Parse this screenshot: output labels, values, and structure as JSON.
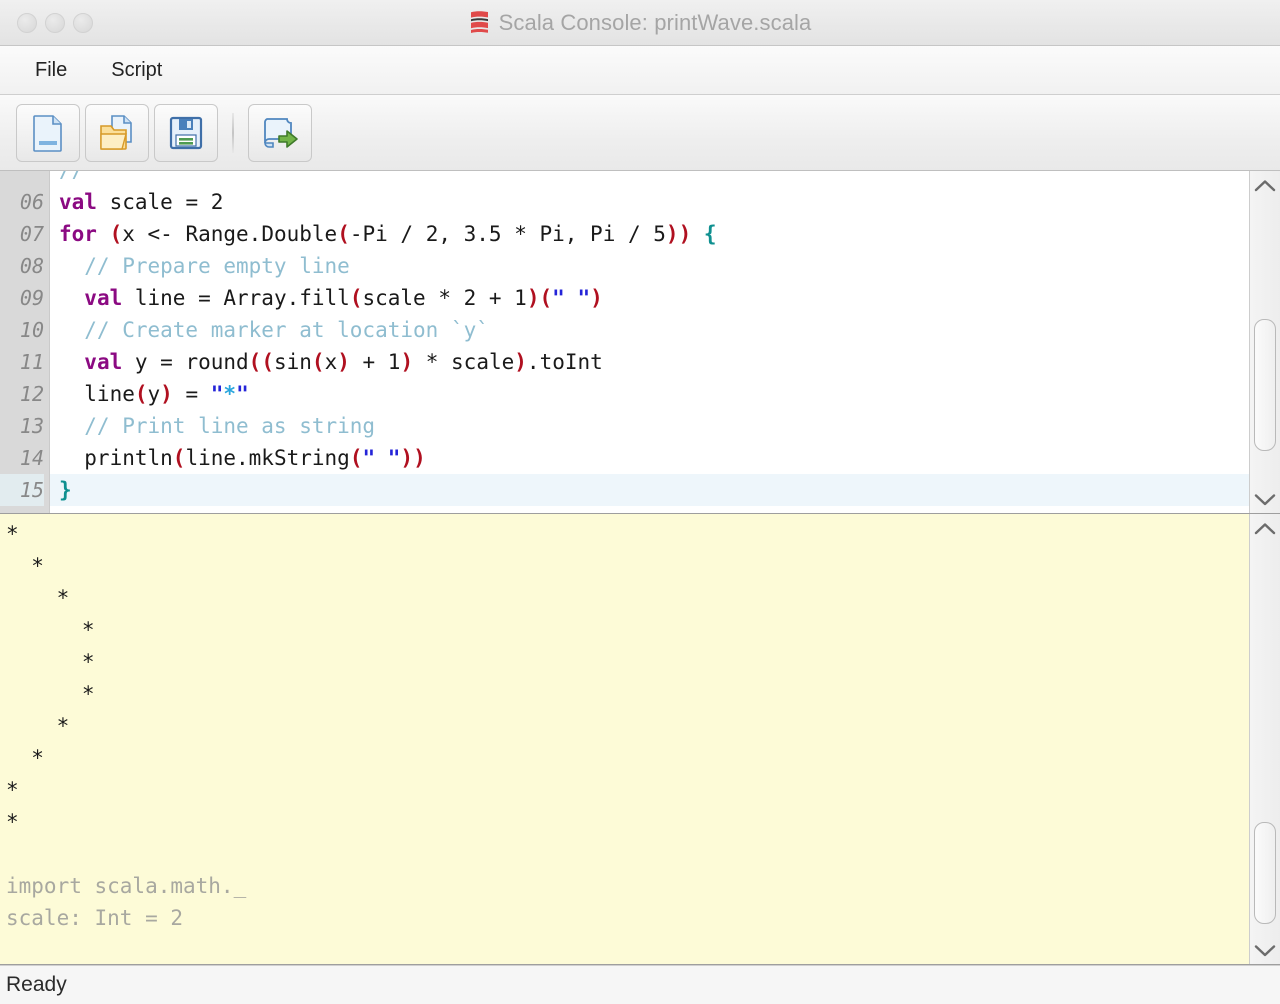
{
  "window": {
    "title": "Scala Console: printWave.scala",
    "logo_icon": "scala-logo-icon",
    "traffic_lights": [
      "close-button",
      "minimize-button",
      "zoom-button"
    ]
  },
  "menubar": {
    "items": [
      {
        "label": "File",
        "name": "menu-file"
      },
      {
        "label": "Script",
        "name": "menu-script"
      }
    ]
  },
  "toolbar": {
    "buttons": [
      {
        "name": "new-file-button",
        "icon": "new-file-icon",
        "tooltip": "New"
      },
      {
        "name": "open-file-button",
        "icon": "open-folder-icon",
        "tooltip": "Open"
      },
      {
        "name": "save-file-button",
        "icon": "floppy-disk-save-icon",
        "tooltip": "Save"
      },
      {
        "name": "run-script-button",
        "icon": "run-script-arrow-icon",
        "tooltip": "Run"
      }
    ]
  },
  "editor": {
    "language": "Scala",
    "first_visible_line": 6,
    "current_line": 15,
    "lines": [
      {
        "num": "06",
        "tokens": [
          {
            "t": "val",
            "c": "t-kw"
          },
          {
            "t": " scale = 2",
            "c": "t-plain"
          }
        ]
      },
      {
        "num": "07",
        "tokens": [
          {
            "t": "for",
            "c": "t-kw"
          },
          {
            "t": " ",
            "c": "t-plain"
          },
          {
            "t": "(",
            "c": "t-par"
          },
          {
            "t": "x <- Range.Double",
            "c": "t-plain"
          },
          {
            "t": "(",
            "c": "t-par"
          },
          {
            "t": "-Pi / 2, 3.5 * Pi, Pi / 5",
            "c": "t-plain"
          },
          {
            "t": "))",
            "c": "t-par"
          },
          {
            "t": " ",
            "c": "t-plain"
          },
          {
            "t": "{",
            "c": "t-brc"
          }
        ]
      },
      {
        "num": "08",
        "tokens": [
          {
            "t": "  // Prepare empty line",
            "c": "t-cmt"
          }
        ]
      },
      {
        "num": "09",
        "tokens": [
          {
            "t": "  ",
            "c": "t-plain"
          },
          {
            "t": "val",
            "c": "t-kw"
          },
          {
            "t": " line = Array.fill",
            "c": "t-plain"
          },
          {
            "t": "(",
            "c": "t-par"
          },
          {
            "t": "scale * 2 + 1",
            "c": "t-plain"
          },
          {
            "t": ")",
            "c": "t-par"
          },
          {
            "t": "(",
            "c": "t-par"
          },
          {
            "t": "\" \"",
            "c": "t-str"
          },
          {
            "t": ")",
            "c": "t-par"
          }
        ]
      },
      {
        "num": "10",
        "tokens": [
          {
            "t": "  // Create marker at location `y`",
            "c": "t-cmt"
          }
        ]
      },
      {
        "num": "11",
        "tokens": [
          {
            "t": "  ",
            "c": "t-plain"
          },
          {
            "t": "val",
            "c": "t-kw"
          },
          {
            "t": " y = round",
            "c": "t-plain"
          },
          {
            "t": "((",
            "c": "t-par"
          },
          {
            "t": "sin",
            "c": "t-plain"
          },
          {
            "t": "(",
            "c": "t-par"
          },
          {
            "t": "x",
            "c": "t-plain"
          },
          {
            "t": ")",
            "c": "t-par"
          },
          {
            "t": " + 1",
            "c": "t-plain"
          },
          {
            "t": ")",
            "c": "t-par"
          },
          {
            "t": " * scale",
            "c": "t-plain"
          },
          {
            "t": ")",
            "c": "t-par"
          },
          {
            "t": ".toInt",
            "c": "t-plain"
          }
        ]
      },
      {
        "num": "12",
        "tokens": [
          {
            "t": "  line",
            "c": "t-plain"
          },
          {
            "t": "(",
            "c": "t-par"
          },
          {
            "t": "y",
            "c": "t-plain"
          },
          {
            "t": ")",
            "c": "t-par"
          },
          {
            "t": " = ",
            "c": "t-plain"
          },
          {
            "t": "\"",
            "c": "t-str"
          },
          {
            "t": "*",
            "c": "t-strc"
          },
          {
            "t": "\"",
            "c": "t-str"
          }
        ]
      },
      {
        "num": "13",
        "tokens": [
          {
            "t": "  // Print line as string",
            "c": "t-cmt"
          }
        ]
      },
      {
        "num": "14",
        "tokens": [
          {
            "t": "  println",
            "c": "t-plain"
          },
          {
            "t": "(",
            "c": "t-par"
          },
          {
            "t": "line.mkString",
            "c": "t-plain"
          },
          {
            "t": "(",
            "c": "t-par"
          },
          {
            "t": "\" \"",
            "c": "t-str"
          },
          {
            "t": "))",
            "c": "t-par"
          }
        ]
      },
      {
        "num": "15",
        "tokens": [
          {
            "t": "}",
            "c": "t-brc"
          }
        ],
        "current": true
      }
    ],
    "scrollbar": {
      "up_icon": "chevron-up-icon",
      "down_icon": "chevron-down-icon",
      "thumb_top_pct": 42,
      "thumb_height_pct": 46
    }
  },
  "console": {
    "output_lines": [
      "*",
      "  *",
      "    *",
      "      *",
      "      *",
      "      *",
      "    *",
      "  *",
      "*",
      "*",
      "",
      "import scala.math._",
      "scale: Int = 2"
    ],
    "meta_from_index": 11,
    "scrollbar": {
      "up_icon": "chevron-up-icon",
      "down_icon": "chevron-down-icon",
      "thumb_top_pct": 71,
      "thumb_height_pct": 26
    }
  },
  "statusbar": {
    "message": "Ready"
  },
  "colors": {
    "console_background": "#fdfbd7",
    "editor_background": "#ffffff",
    "gutter_background": "#d9d9d9",
    "current_line_highlight": "#eef6fb",
    "scala_red": "#dc322f",
    "keyword": "#8b0a82",
    "paren": "#b01020",
    "brace": "#0f9090",
    "comment": "#8fbdd0",
    "string": "#2424d8",
    "title_text": "#a5a5a5"
  }
}
